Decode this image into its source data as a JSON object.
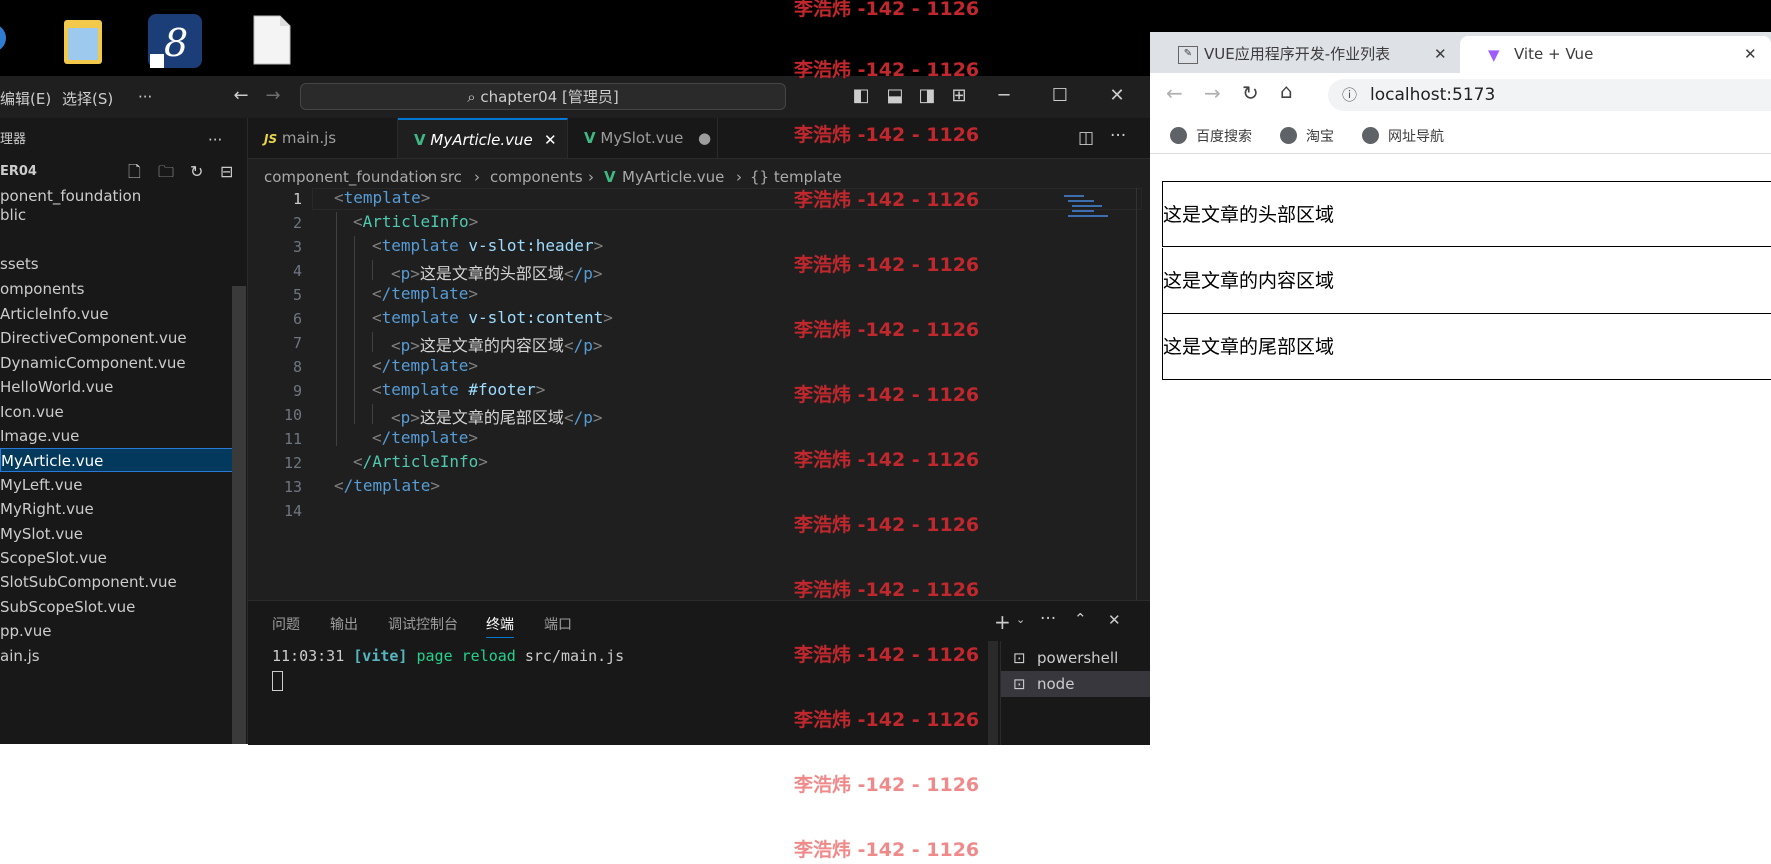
{
  "vscode": {
    "menu": [
      "编辑(E)",
      "选择(S)",
      "···"
    ],
    "search": "chapter04 [管理员]",
    "explorer_title": "理器",
    "root_folder": "ER04",
    "tree": [
      "ponent_foundation",
      "blic",
      "",
      "ssets",
      "omponents",
      "ArticleInfo.vue",
      "DirectiveComponent.vue",
      "DynamicComponent.vue",
      "HelloWorld.vue",
      "Icon.vue",
      "Image.vue",
      "MyArticle.vue",
      "MyLeft.vue",
      "MyRight.vue",
      "MySlot.vue",
      "ScopeSlot.vue",
      "SlotSubComponent.vue",
      "SubScopeSlot.vue",
      "pp.vue",
      "ain.js"
    ],
    "selected_file": "MyArticle.vue",
    "tabs": [
      {
        "label": "main.js",
        "icon": "JS"
      },
      {
        "label": "MyArticle.vue",
        "icon": "V"
      },
      {
        "label": "MySlot.vue",
        "icon": "V"
      }
    ],
    "breadcrumb": [
      "component_foundation",
      "src",
      "components",
      "MyArticle.vue",
      "{} template"
    ],
    "line_numbers": [
      "1",
      "2",
      "3",
      "4",
      "5",
      "6",
      "7",
      "8",
      "9",
      "10",
      "11",
      "12",
      "13",
      "14"
    ],
    "code": {
      "l1_tag": "template",
      "l2_tag": "ArticleInfo",
      "l3_tag": "template",
      "l3_attr": "v-slot:header",
      "l4_tag": "p",
      "l4_text": "这是文章的头部区域",
      "l4_close": "/p",
      "l5_tag": "/template",
      "l6_tag": "template",
      "l6_attr": "v-slot:content",
      "l7_tag": "p",
      "l7_text": "这是文章的内容区域",
      "l7_close": "/p",
      "l8_tag": "/template",
      "l9_tag": "template",
      "l9_attr": "#footer",
      "l10_tag": "p",
      "l10_text": "这是文章的尾部区域",
      "l10_close": "/p",
      "l11_tag": "/template",
      "l12_tag": "/ArticleInfo",
      "l13_tag": "/template"
    },
    "panel_tabs": [
      "问题",
      "输出",
      "调试控制台",
      "终端",
      "端口"
    ],
    "terminal": {
      "time": "11:03:31",
      "tag": "[vite]",
      "msg": "page reload",
      "file": "src/main.js"
    },
    "terminals": [
      "powershell",
      "node"
    ]
  },
  "browser": {
    "tabs": [
      "VUE应用程序开发-作业列表",
      "Vite + Vue"
    ],
    "url": "localhost:5173",
    "bookmarks": [
      "百度搜索",
      "淘宝",
      "网址导航"
    ],
    "content": [
      "这是文章的头部区域",
      "这是文章的内容区域",
      "这是文章的尾部区域"
    ]
  },
  "watermark": "李浩炜 -142 - 1126",
  "colors": {
    "accent": "#0078d4",
    "watermark_dark": "#c0282d",
    "watermark_light": "#f08a8a"
  }
}
